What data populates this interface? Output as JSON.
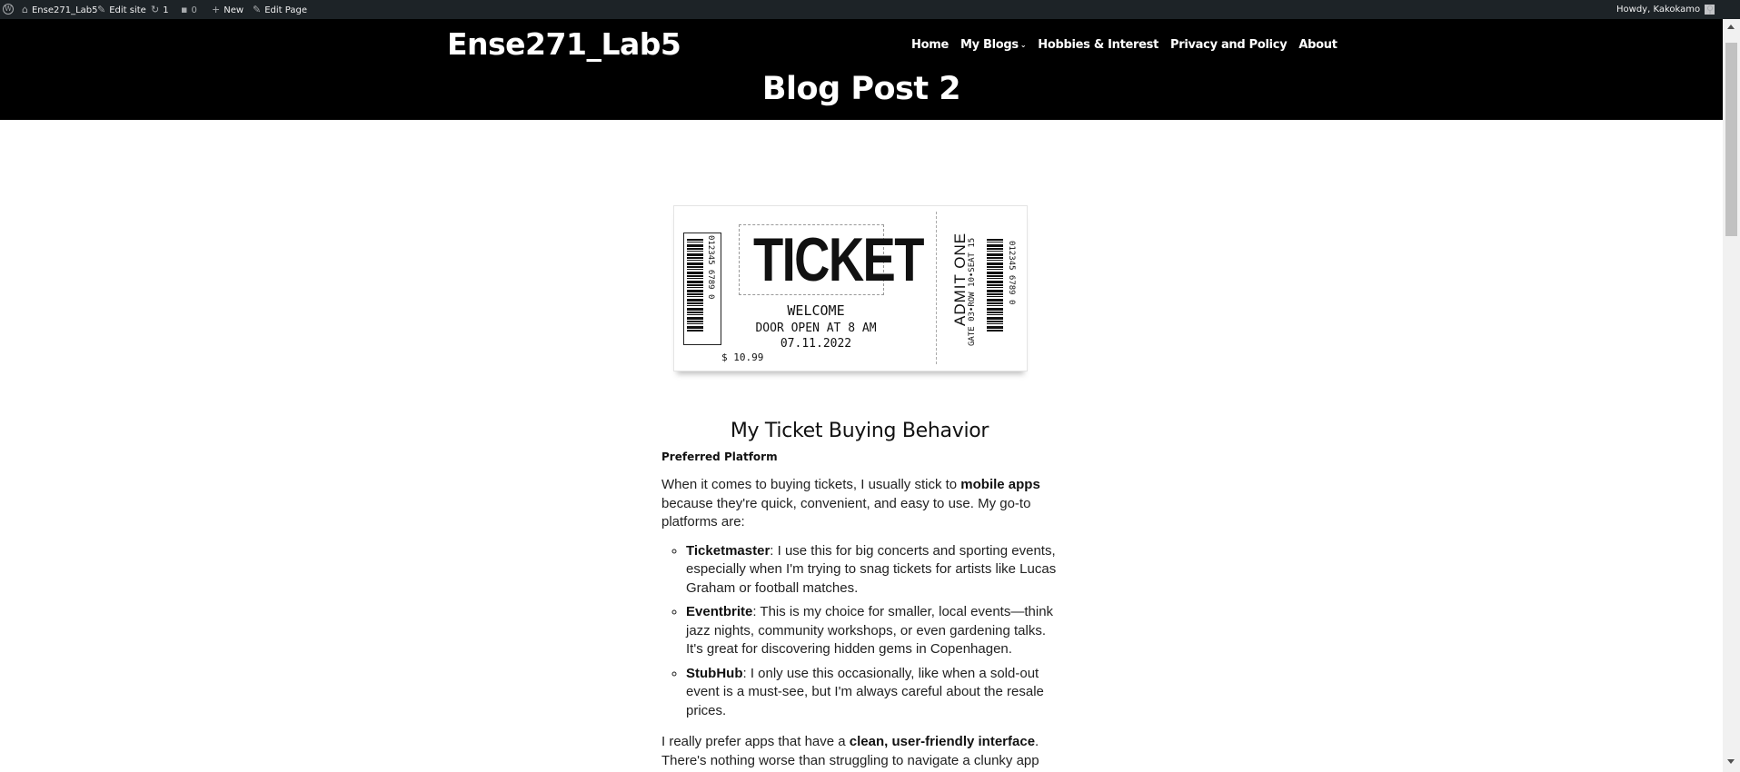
{
  "admin_bar": {
    "site_name": "Ense271_Lab5",
    "edit_site": "Edit site",
    "updates_count": "1",
    "comments_count": "0",
    "new_label": "New",
    "edit_page": "Edit Page",
    "greeting": "Howdy, Kakokamo"
  },
  "header": {
    "site_title": "Ense271_Lab5",
    "nav": [
      "Home",
      "My Blogs",
      "Hobbies & Interest",
      "Privacy and Policy",
      "About"
    ],
    "page_title": "Blog Post 2"
  },
  "ticket": {
    "headline": "TICKET",
    "welcome": "WELCOME",
    "door": "DOOR OPEN AT 8 AM",
    "date": "07.11.2022",
    "price": "$ 10.99",
    "admit": "ADMIT ONE",
    "gate": "GATE 03•ROW 10•SEAT 15",
    "barcode_number": "012345  6789  0"
  },
  "article": {
    "heading": "My Ticket Buying Behavior",
    "subheading": "Preferred Platform",
    "intro_before": "When it comes to buying tickets, I usually stick to ",
    "intro_bold": "mobile apps",
    "intro_after": " because they're quick, convenient, and easy to use. My go-to platforms are:",
    "items": [
      {
        "name": "Ticketmaster",
        "text": ": I use this for big concerts and sporting events, especially when I'm trying to snag tickets for artists like Lucas Graham or football matches."
      },
      {
        "name": "Eventbrite",
        "text": ": This is my choice for smaller, local events—think jazz nights, community workshops, or even gardening talks. It's great for discovering hidden gems in Copenhagen."
      },
      {
        "name": "StubHub",
        "text": ": I only use this occasionally, like when a sold-out event is a must-see, but I'm always careful about the resale prices."
      }
    ],
    "closing_before": "I really prefer apps that have a ",
    "closing_bold": "clean, user-friendly interface",
    "closing_after": ". There's nothing worse than struggling to navigate a clunky app"
  }
}
